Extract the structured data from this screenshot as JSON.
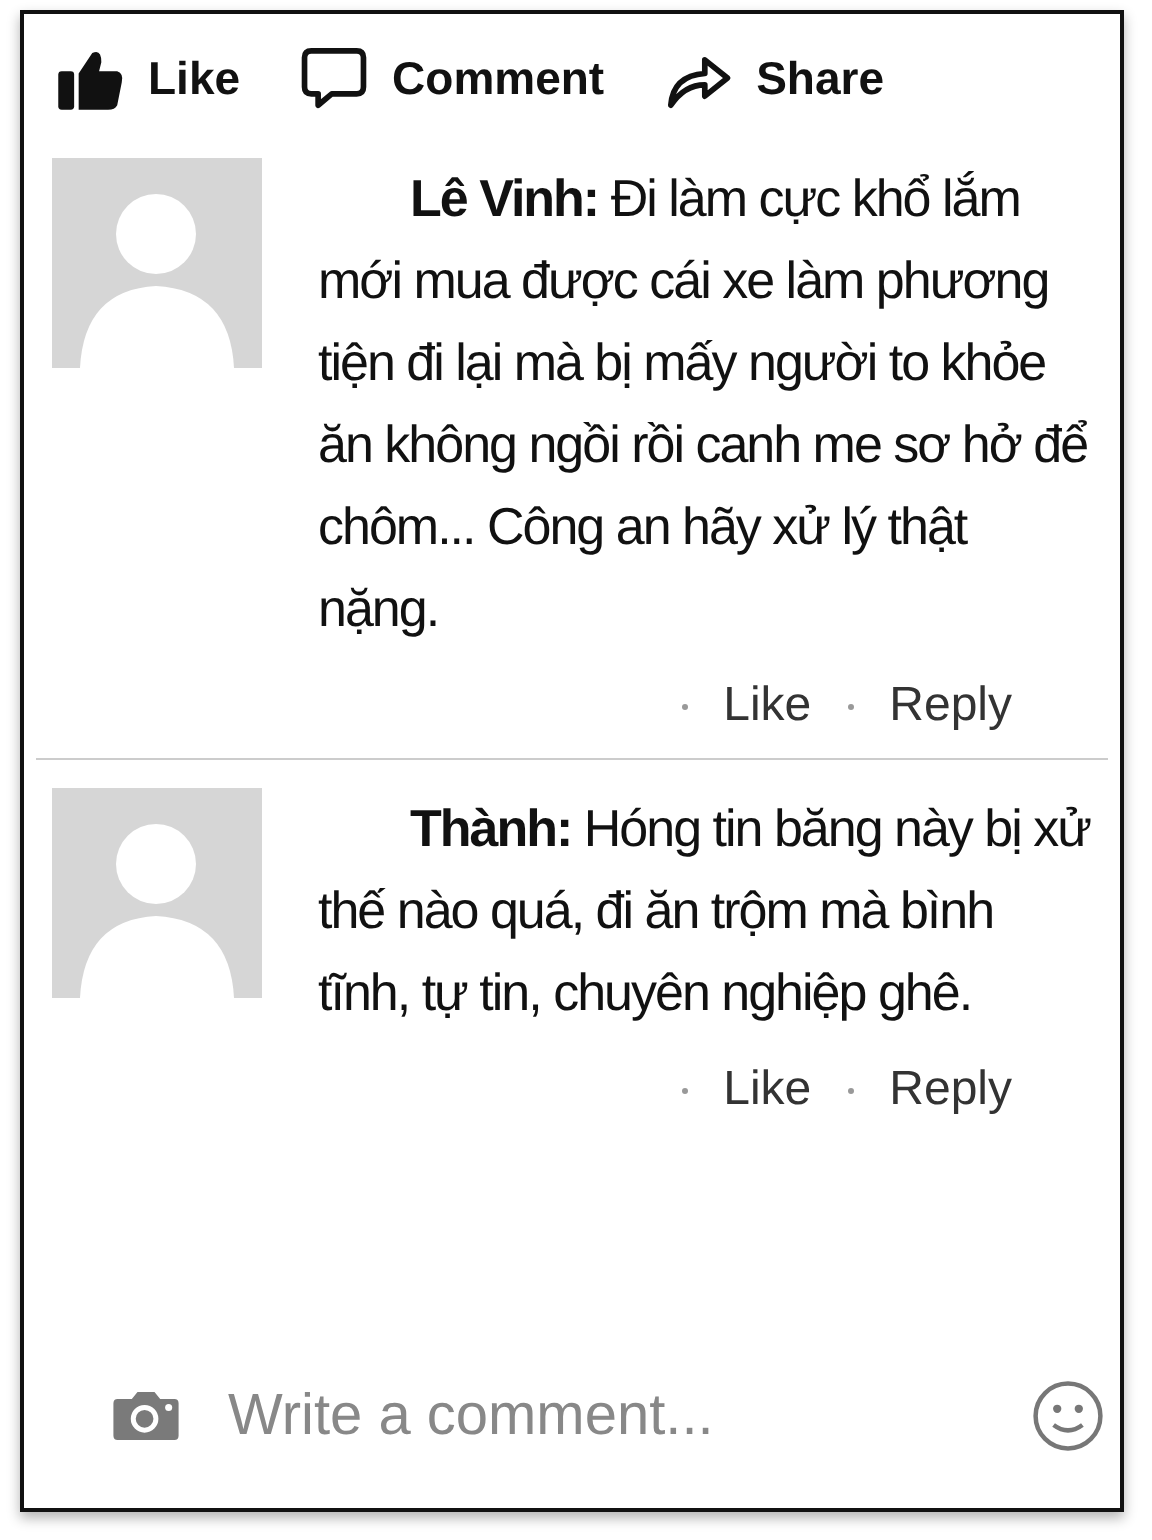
{
  "actions": [
    {
      "kind": "like",
      "label": "Like"
    },
    {
      "kind": "comment",
      "label": "Comment"
    },
    {
      "kind": "share",
      "label": "Share"
    }
  ],
  "comments": [
    {
      "text": "**Lê Vinh:** Đi làm cực khổ lắm mới mua được cái xe làm phương tiện đi lại mà bị mấy người to khỏe ăn không ngồi rồi canh me sơ hở để chôm... Công an hãy xử lý thật nặng.",
      "like": "Like",
      "reply": "Reply"
    },
    {
      "text": "**Thành:** Hóng tin băng này bị xử thế nào quá, đi ăn trộm mà bình tĩnh, tự tin, chuyên nghiệp ghê.",
      "like": "Like",
      "reply": "Reply"
    }
  ],
  "composer": {
    "placeholder": "Write a comment..."
  }
}
